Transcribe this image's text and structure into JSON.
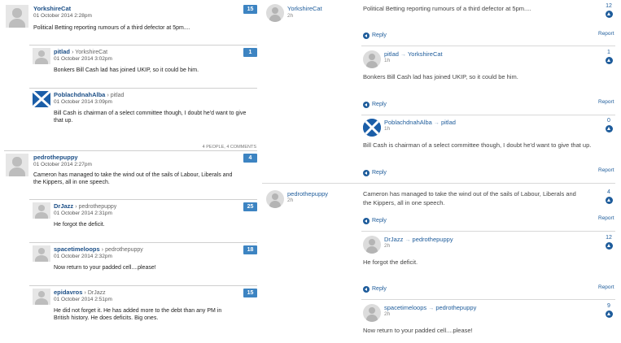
{
  "left": {
    "comments": [
      {
        "author": "YorkshireCat",
        "reply_to": "",
        "date": "01 October 2014 2:28pm",
        "votes": "15",
        "body": "Political Betting reporting rumours of a third defector at 5pm...."
      },
      {
        "author": "pitlad",
        "reply_to": "YorkshireCat",
        "date": "01 October 2014 3:02pm",
        "votes": "1",
        "body": "Bonkers Bill Cash lad has joined UKIP, so it could be him."
      },
      {
        "author": "PoblachdnahAlba",
        "reply_to": "pitlad",
        "date": "01 October 2014 3:09pm",
        "votes": "",
        "body": "Bill Cash is chairman of a select committee though, I doubt he'd want to give that up."
      },
      {
        "author": "pedrothepuppy",
        "reply_to": "",
        "date": "01 October 2014 2:27pm",
        "votes": "4",
        "body": "Cameron has managed to take the wind out of the sails of Labour, Liberals and the Kippers, all in one speech."
      },
      {
        "author": "DrJazz",
        "reply_to": "pedrothepuppy",
        "date": "01 October 2014 2:31pm",
        "votes": "25",
        "body": "He forgot the deficit."
      },
      {
        "author": "spacetimeloops",
        "reply_to": "pedrothepuppy",
        "date": "01 October 2014 2:32pm",
        "votes": "18",
        "body": "Now return to your padded cell....please!"
      },
      {
        "author": "epidavros",
        "reply_to": "DrJazz",
        "date": "01 October 2014 2:51pm",
        "votes": "15",
        "body": "He did not forget it. He has added more to the debt than any PM in British history. He does deficits. Big ones."
      }
    ],
    "thread_meta": "4 PEOPLE, 4 COMMENTS"
  },
  "right": {
    "comments": [
      {
        "author": "YorkshireCat",
        "reply_to": "",
        "time": "2h",
        "votes": "12",
        "body": "Political Betting reporting rumours of a third defector at 5pm...."
      },
      {
        "author": "pitlad",
        "reply_to": "YorkshireCat",
        "time": "1h",
        "votes": "1",
        "body": "Bonkers Bill Cash lad has joined UKIP, so it could be him."
      },
      {
        "author": "PoblachdnahAlba",
        "reply_to": "pitlad",
        "time": "1h",
        "votes": "0",
        "body": "Bill Cash is chairman of a select committee though, I doubt he'd want to give that up."
      },
      {
        "author": "pedrothepuppy",
        "reply_to": "",
        "time": "2h",
        "votes": "4",
        "body": "Cameron has managed to take the wind out of the sails of Labour, Liberals and the Kippers, all in one speech."
      },
      {
        "author": "DrJazz",
        "reply_to": "pedrothepuppy",
        "time": "2h",
        "votes": "12",
        "body": "He forgot the deficit."
      },
      {
        "author": "spacetimeloops",
        "reply_to": "pedrothepuppy",
        "time": "2h",
        "votes": "9",
        "body": "Now return to your padded cell....please!"
      }
    ],
    "reply_label": "Reply",
    "report_label": "Report",
    "reply_arrow": "→"
  },
  "colors": {
    "accent": "#1e5c9b",
    "badge": "#3d84c2",
    "name_left": "#1c4f87"
  }
}
